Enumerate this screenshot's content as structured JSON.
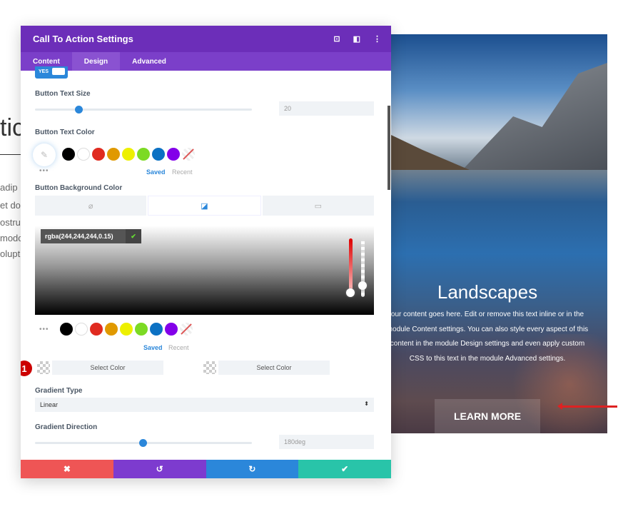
{
  "background_page": {
    "title_fragment": "tic",
    "text_lines": [
      "adip",
      "et do",
      "ostruc",
      "modc",
      "olupt"
    ]
  },
  "hero": {
    "title": "Landscapes",
    "body": "our content goes here. Edit or remove this text inline or in the module Content settings. You can also style every aspect of this content in the module Design settings and even apply custom CSS to this text in the module Advanced settings.",
    "button": "LEARN MORE"
  },
  "panel": {
    "title": "Call To Action Settings",
    "icons": [
      "screenshot-icon",
      "sidebar-toggle-icon",
      "more-options-icon"
    ],
    "tabs": [
      {
        "label": "Content"
      },
      {
        "label": "Design",
        "active": true
      },
      {
        "label": "Advanced"
      }
    ],
    "toggle_label": "YES",
    "button_text_size": {
      "label": "Button Text Size",
      "value": "20",
      "slider_fraction": 0.2
    },
    "button_text_color": {
      "label": "Button Text Color",
      "saved": "Saved",
      "recent": "Recent"
    },
    "button_bg_color": {
      "label": "Button Background Color",
      "color_value": "rgba(244,244,244,0.15)",
      "saved": "Saved",
      "recent": "Recent",
      "active_tab": "gradient"
    },
    "swatches": [
      "#000000",
      "#ffffff",
      "#e02b20",
      "#e09900",
      "#edf000",
      "#7cda24",
      "#0c71c3",
      "#8300e9"
    ],
    "gradient_stops": [
      {
        "label": "Select Color"
      },
      {
        "label": "Select Color"
      }
    ],
    "step_badge": "1",
    "gradient_type": {
      "label": "Gradient Type",
      "value": "Linear"
    },
    "gradient_direction": {
      "label": "Gradient Direction",
      "value": "180deg",
      "slider_fraction": 0.5
    },
    "footer": {
      "cancel": "✖",
      "undo": "↺",
      "redo": "↻",
      "save": "✔"
    },
    "colors": {
      "header": "#6c2eb9",
      "tabs": "#7b3fc9",
      "accent": "#2b87da",
      "cancel": "#ef5555",
      "undo": "#7d3bcf",
      "redo": "#2b87da",
      "save": "#29c4a9"
    }
  }
}
